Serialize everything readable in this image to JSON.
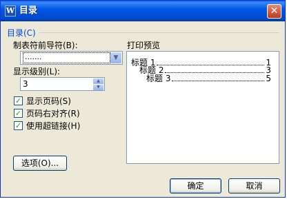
{
  "window": {
    "title": "目录",
    "app_icon_glyph": "W",
    "close_glyph": "✕"
  },
  "section": {
    "label": "目录(C)"
  },
  "tab_leader": {
    "label": "制表符前导符(B):",
    "value": ".......",
    "arrow_glyph": "▼"
  },
  "levels": {
    "label": "显示级别(L):",
    "value": "3",
    "up_glyph": "▲",
    "down_glyph": "▼"
  },
  "checkboxes": [
    {
      "label": "显示页码(S)",
      "checked": true,
      "glyph": "✓"
    },
    {
      "label": "页码右对齐(R)",
      "checked": true,
      "glyph": "✓"
    },
    {
      "label": "使用超链接(H)",
      "checked": true,
      "glyph": "✓"
    }
  ],
  "preview": {
    "label": "打印预览",
    "entries": [
      {
        "text": "标题 1",
        "page": "1"
      },
      {
        "text": "标题 2",
        "page": "3"
      },
      {
        "text": "标题 3",
        "page": "5"
      }
    ]
  },
  "buttons": {
    "options": "选项(O)...",
    "ok": "确定",
    "cancel": "取消"
  },
  "colors": {
    "titlebar": "#0058e6",
    "dialog_bg": "#ece9d8",
    "section_label": "#0046d5",
    "close_button": "#c0391b",
    "check_mark": "#21a121"
  }
}
